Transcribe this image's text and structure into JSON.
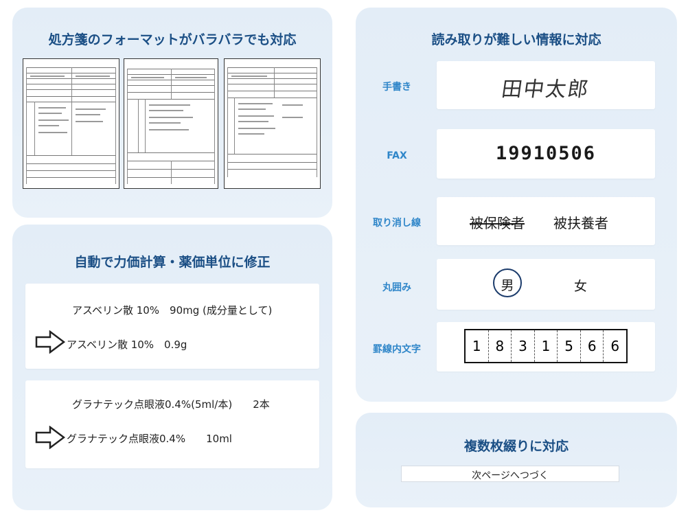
{
  "panel_formats": {
    "title": "処方箋のフォーマットがバラバラでも対応"
  },
  "panel_calc": {
    "title": "自動で力価計算・薬価単位に修正",
    "examples": [
      {
        "before": "アスベリン散 10%　90mg (成分量として)",
        "after": "アスベリン散 10%　0.9g"
      },
      {
        "before": "グラナテック点眼液0.4%(5ml/本)　　2本",
        "after": "グラナテック点眼液0.4%　　10ml"
      }
    ]
  },
  "panel_read": {
    "title": "読み取りが難しい情報に対応",
    "rows": [
      {
        "label": "手書き",
        "value": "田中太郎"
      },
      {
        "label": "FAX",
        "value": "19910506"
      },
      {
        "label": "取り消し線",
        "struck": "被保険者",
        "value": "被扶養者"
      },
      {
        "label": "丸囲み",
        "circled": "男",
        "other": "女"
      },
      {
        "label": "罫線内文字",
        "digits": [
          "1",
          "8",
          "3",
          "1",
          "5",
          "6",
          "6"
        ]
      }
    ]
  },
  "panel_multi": {
    "title": "複数枚綴りに対応",
    "note": "次ページへつづく"
  },
  "colors": {
    "title": "#1b4f85",
    "label": "#2f86c9",
    "panel_bg": "#e6eff8"
  }
}
